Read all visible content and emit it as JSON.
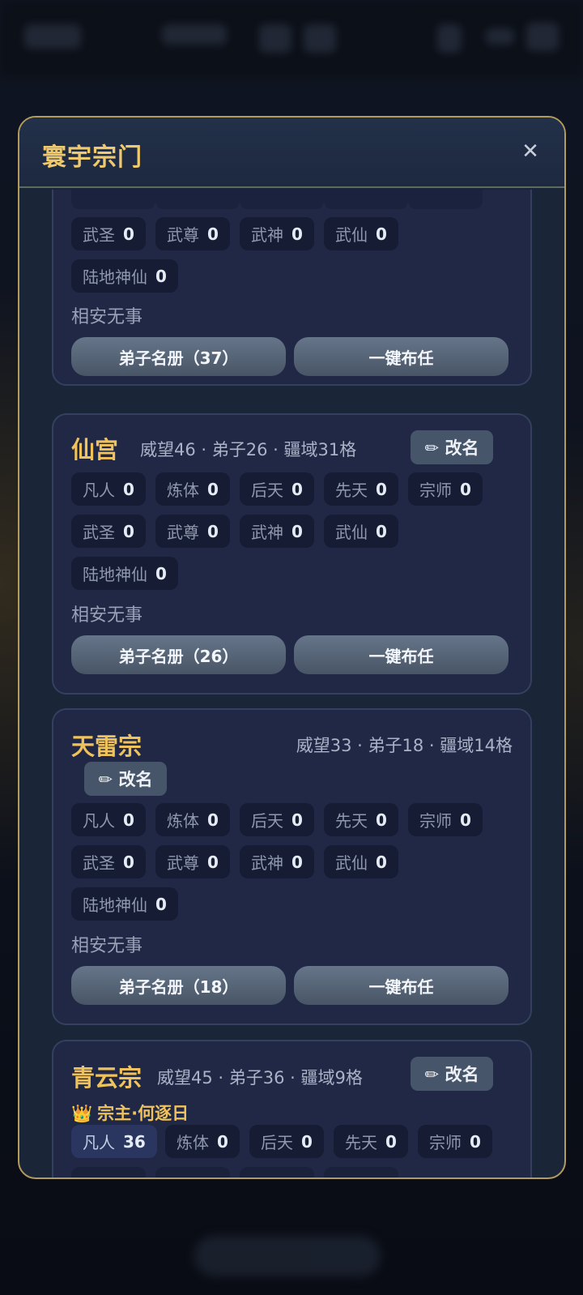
{
  "modal": {
    "title": "寰宇宗门",
    "close_symbol": "✕"
  },
  "rename_label": "✏ 改名",
  "status_idle": "相安无事",
  "roster_btn_prefix": "弟子名册（",
  "assign_label": "一键布任",
  "sects": [
    {
      "name": "",
      "stats": "",
      "ranks": [
        {
          "label": "武圣",
          "value": "0"
        },
        {
          "label": "武尊",
          "value": "0"
        },
        {
          "label": "武神",
          "value": "0"
        },
        {
          "label": "武仙",
          "value": "0"
        },
        {
          "label": "陆地神仙",
          "value": "0"
        }
      ],
      "status": "相安无事",
      "roster_label": "弟子名册（37）",
      "assign_label": "一键布任"
    },
    {
      "name": "仙宫",
      "stats": "威望46 · 弟子26 · 疆域31格",
      "ranks": [
        {
          "label": "凡人",
          "value": "0"
        },
        {
          "label": "炼体",
          "value": "0"
        },
        {
          "label": "后天",
          "value": "0"
        },
        {
          "label": "先天",
          "value": "0"
        },
        {
          "label": "宗师",
          "value": "0"
        },
        {
          "label": "武圣",
          "value": "0"
        },
        {
          "label": "武尊",
          "value": "0"
        },
        {
          "label": "武神",
          "value": "0"
        },
        {
          "label": "武仙",
          "value": "0"
        },
        {
          "label": "陆地神仙",
          "value": "0"
        }
      ],
      "status": "相安无事",
      "roster_label": "弟子名册（26）",
      "assign_label": "一键布任"
    },
    {
      "name": "天雷宗",
      "stats": "威望33 · 弟子18 · 疆域14格",
      "ranks": [
        {
          "label": "凡人",
          "value": "0"
        },
        {
          "label": "炼体",
          "value": "0"
        },
        {
          "label": "后天",
          "value": "0"
        },
        {
          "label": "先天",
          "value": "0"
        },
        {
          "label": "宗师",
          "value": "0"
        },
        {
          "label": "武圣",
          "value": "0"
        },
        {
          "label": "武尊",
          "value": "0"
        },
        {
          "label": "武神",
          "value": "0"
        },
        {
          "label": "武仙",
          "value": "0"
        },
        {
          "label": "陆地神仙",
          "value": "0"
        }
      ],
      "status": "相安无事",
      "roster_label": "弟子名册（18）",
      "assign_label": "一键布任"
    },
    {
      "name": "青云宗",
      "stats": "威望45 · 弟子36 · 疆域9格",
      "leader": "宗主·何逐日",
      "leader_icon": "👑",
      "ranks": [
        {
          "label": "凡人",
          "value": "36"
        },
        {
          "label": "炼体",
          "value": "0"
        },
        {
          "label": "后天",
          "value": "0"
        },
        {
          "label": "先天",
          "value": "0"
        },
        {
          "label": "宗师",
          "value": "0"
        }
      ]
    }
  ],
  "colors": {
    "accent_gold": "#efc25b",
    "modal_border": "#b39b5c",
    "card_bg": "#202846"
  }
}
